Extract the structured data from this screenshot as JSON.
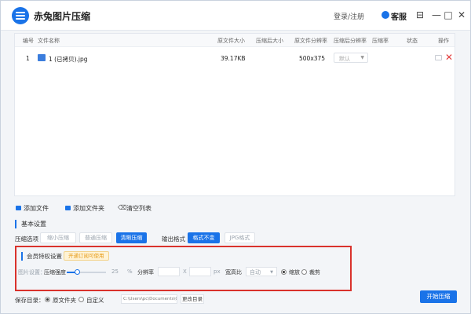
{
  "app": {
    "title": "赤兔图片压缩"
  },
  "titlebar": {
    "login": "登录/注册",
    "service": "客服",
    "min": "—",
    "max": "□",
    "close": "✕",
    "extra": "⊟"
  },
  "table": {
    "headers": [
      "编号",
      "文件名称",
      "原文件大小",
      "压缩后大小",
      "原文件分辨率",
      "压缩后分辨率",
      "压缩率",
      "状态",
      "操作"
    ],
    "rows": [
      {
        "index": "1",
        "name": "1 (已拷贝).jpg",
        "size": "39.17KB",
        "resolution": "500x375",
        "select": "默认"
      }
    ]
  },
  "toolbar": {
    "add_file": "添加文件",
    "add_folder": "添加文件夹",
    "clear": "清空列表"
  },
  "basic": {
    "title": "基本设置",
    "compress_label": "压缩选项",
    "compress_options": [
      "缩小压缩",
      "普通压缩",
      "清晰压缩"
    ],
    "output_label": "输出格式",
    "output_options": [
      "格式不变",
      "JPG格式"
    ]
  },
  "member": {
    "title": "会员特权设置",
    "badge": "开通订阅可使用",
    "image_settings": "图片设置：",
    "strength_label": "压缩强度",
    "strength_value": "25",
    "percent": "%",
    "resolution_label": "分辨率",
    "x_sep": "X",
    "px": "px",
    "aspect_label": "宽高比",
    "aspect_value": "自动",
    "scale": "缩放",
    "crop": "裁剪"
  },
  "save": {
    "label": "保存目录：",
    "original_folder": "原文件夹",
    "custom": "自定义",
    "path": "C:\\Users\\pc\\Documents\\CTImageCo",
    "change": "更改目录"
  },
  "start_button": "开始压缩",
  "colors": {
    "accent": "#1a73e8",
    "highlight": "#d9322c",
    "delete": "#e23b3b"
  }
}
